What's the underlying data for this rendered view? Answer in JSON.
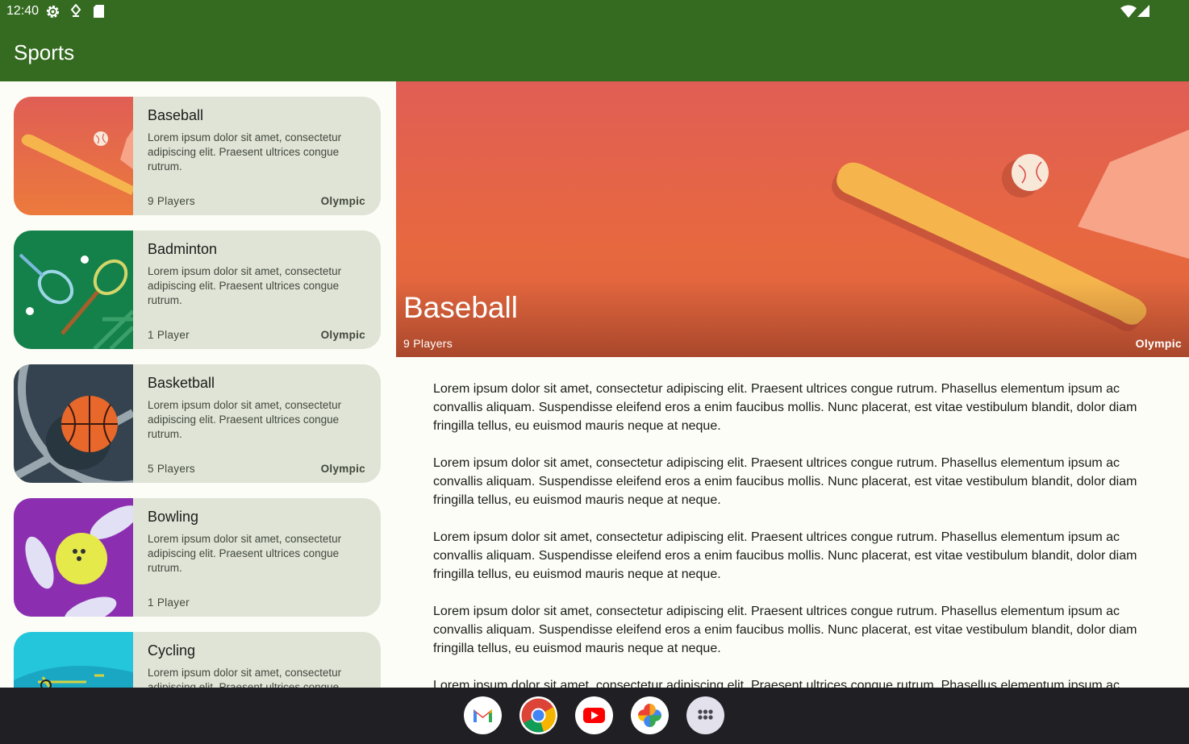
{
  "status_bar": {
    "time": "12:40",
    "icons": [
      "settings-icon",
      "location-icon",
      "sd-card-icon",
      "wifi-icon",
      "signal-icon"
    ]
  },
  "app_bar": {
    "title": "Sports"
  },
  "sports": [
    {
      "title": "Baseball",
      "description": "Lorem ipsum dolor sit amet, consectetur adipiscing elit. Praesent ultrices congue rutrum.",
      "players": "9 Players",
      "olympic": "Olympic"
    },
    {
      "title": "Badminton",
      "description": "Lorem ipsum dolor sit amet, consectetur adipiscing elit. Praesent ultrices congue rutrum.",
      "players": "1 Player",
      "olympic": "Olympic"
    },
    {
      "title": "Basketball",
      "description": "Lorem ipsum dolor sit amet, consectetur adipiscing elit. Praesent ultrices congue rutrum.",
      "players": "5 Players",
      "olympic": "Olympic"
    },
    {
      "title": "Bowling",
      "description": "Lorem ipsum dolor sit amet, consectetur adipiscing elit. Praesent ultrices congue rutrum.",
      "players": "1 Player",
      "olympic": ""
    },
    {
      "title": "Cycling",
      "description": "Lorem ipsum dolor sit amet, consectetur adipiscing elit. Praesent ultrices congue rutrum."
    }
  ],
  "detail": {
    "title": "Baseball",
    "players": "9 Players",
    "olympic": "Olympic",
    "paragraphs": [
      "Lorem ipsum dolor sit amet, consectetur adipiscing elit. Praesent ultrices congue rutrum. Phasellus elementum ipsum ac convallis aliquam. Suspendisse eleifend eros a enim faucibus mollis. Nunc placerat, est vitae vestibulum blandit, dolor diam fringilla tellus, eu euismod mauris neque at neque.",
      " Lorem ipsum dolor sit amet, consectetur adipiscing elit. Praesent ultrices congue rutrum. Phasellus elementum ipsum ac convallis aliquam. Suspendisse eleifend eros a enim faucibus mollis. Nunc placerat, est vitae vestibulum blandit, dolor diam fringilla tellus, eu euismod mauris neque at neque.",
      " Lorem ipsum dolor sit amet, consectetur adipiscing elit. Praesent ultrices congue rutrum. Phasellus elementum ipsum ac convallis aliquam. Suspendisse eleifend eros a enim faucibus mollis. Nunc placerat, est vitae vestibulum blandit, dolor diam fringilla tellus, eu euismod mauris neque at neque.",
      " Lorem ipsum dolor sit amet, consectetur adipiscing elit. Praesent ultrices congue rutrum. Phasellus elementum ipsum ac convallis aliquam. Suspendisse eleifend eros a enim faucibus mollis. Nunc placerat, est vitae vestibulum blandit, dolor diam fringilla tellus, eu euismod mauris neque at neque.",
      " Lorem ipsum dolor sit amet, consectetur adipiscing elit. Praesent ultrices congue rutrum. Phasellus elementum ipsum ac convallis aliquam. Suspendisse eleifend eros a enim faucibus mollis. Nunc placerat, est vitae vestibulum blandit, dolor diam fringilla tellus, eu euismod mauris neque at neque."
    ]
  },
  "dock": [
    "gmail-icon",
    "chrome-icon",
    "youtube-icon",
    "photos-icon",
    "app-drawer-icon"
  ],
  "colors": {
    "primary": "#356b21",
    "card": "#dfe4d7",
    "background": "#fcfdf6",
    "taskbar": "#1f1f24"
  }
}
